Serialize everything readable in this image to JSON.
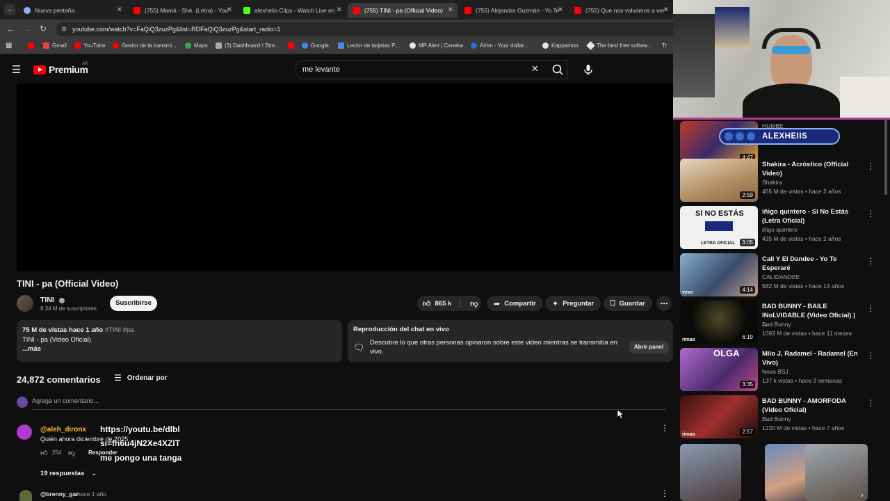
{
  "browser": {
    "tabs": [
      {
        "title": "Nueva pestaña",
        "color": "#8ab4f8"
      },
      {
        "title": "(755) Mamá - Shé. (Letra) - You",
        "color": "#ff0000"
      },
      {
        "title": "alexheiis Clips - Watch Live on",
        "color": "#53fc18"
      },
      {
        "title": "(755) TINI - pa (Official Video)",
        "color": "#ff0000"
      },
      {
        "title": "(755) Alejandra Guzmán - Yo Te",
        "color": "#ff0000"
      },
      {
        "title": "(755) Que nos volvamos a ver",
        "color": "#ff0000"
      }
    ],
    "url": "youtube.com/watch?v=FaQiQ3zuzPg&list=RDFaQiQ3zuzPg&start_radio=1",
    "bookmarks": [
      {
        "label": "Gmail",
        "color": "#ea4335"
      },
      {
        "label": "YouTube",
        "color": "#ff0000"
      },
      {
        "label": "Gestor de la transmi...",
        "color": "#ff0000"
      },
      {
        "label": "Maps",
        "color": "#34a853"
      },
      {
        "label": "(3) Dashboard / Stre...",
        "color": "#aaaaaa"
      },
      {
        "label": "",
        "color": "#ff0000"
      },
      {
        "label": "Google",
        "color": "#4285f4"
      },
      {
        "label": "Lector de tarjetas P...",
        "color": "#4a90d9"
      },
      {
        "label": "MP Alert | Ceneka",
        "color": "#e6e6e6"
      },
      {
        "label": "Airtm - Your dollar...",
        "color": "#2b6ecc"
      },
      {
        "label": "Kappamon",
        "color": "#e6e6e6"
      },
      {
        "label": "The best free softwa...",
        "color": "#e6e6e6"
      },
      {
        "label": "Tr",
        "color": "#e6e6e6"
      }
    ]
  },
  "youtube": {
    "logo": "Premium",
    "region": "AR",
    "search_value": "me levante"
  },
  "video": {
    "title": "TINI - pa (Official Video)",
    "channel": "TINI",
    "subscribers": "9.34 M de suscriptores",
    "subscribe_label": "Suscribirse",
    "likes": "865 k",
    "share_label": "Compartir",
    "ask_label": "Preguntar",
    "save_label": "Guardar",
    "desc_stats": "75 M de vistas  hace 1 año",
    "desc_tags": "#TINI #pa",
    "desc_line": "TINI - pa (Video Oficial)",
    "desc_more": "...más",
    "chat_title": "Reproducción del chat en vivo",
    "chat_text": "Descubre lo que otras personas opinaron sobre este video mientras se transmitía en vivo.",
    "chat_button": "Abrir panel"
  },
  "comments": {
    "count": "24,872 comentarios",
    "sort_label": "Ordenar por",
    "placeholder": "Agrega un comentario...",
    "first": {
      "author": "@aleh_dironx",
      "overlay_line1": "https://youtu.be/dlbl",
      "overlay_line2": "si=fh6u4jN2Xe4XZIT",
      "overlay_line3": "me pongo una tanga",
      "text": "Quién ahora diciembre de 2025",
      "likes": "254",
      "reply_label": "Responder",
      "replies": "19 respuestas"
    },
    "second": {
      "author": "@brenny_gar",
      "time": "hace 1 año"
    }
  },
  "stream_overlay": {
    "name": "ALEXHEIIS"
  },
  "recommendations": [
    {
      "title": "",
      "channel": "HUMBE",
      "meta": "",
      "duration": "4:47",
      "color": "#4a3a6a"
    },
    {
      "title": "Shakira - Acróstico (Official Video)",
      "channel": "Shakira",
      "meta": "455 M de vistas • hace 2 años",
      "duration": "2:59",
      "color": "#c8a27a"
    },
    {
      "title": "iñigo quintero - Si No Estás (Letra Oficial)",
      "channel": "iñigo quintero",
      "meta": "435 M de vistas • hace 2 años",
      "duration": "3:05",
      "color": "#e8e8e8"
    },
    {
      "title": "Cali Y El Dandee - Yo Te Esperaré",
      "channel": "CALIDANDEE",
      "meta": "582 M de vistas • hace 14 años",
      "duration": "4:14",
      "color": "#5a7a9a"
    },
    {
      "title": "BAD BUNNY - BAILE INoLVIDABLE (Video Oficial) | ...",
      "channel": "Bad Bunny",
      "meta": "1093 M de vistas • hace 11 meses",
      "duration": "6:19",
      "color": "#1a1a12"
    },
    {
      "title": "Milo J, Radamel - Radamel (En Vivo)",
      "channel": "Nova BSJ",
      "meta": "137 k vistas • hace 3 semanas",
      "duration": "3:35",
      "color": "#8a5ab0"
    },
    {
      "title": "BAD BUNNY - AMORFODA (Video Oficial)",
      "channel": "Bad Bunny",
      "meta": "1220 M de vistas • hace 7 años",
      "duration": "2:57",
      "color": "#7a2a2a"
    }
  ],
  "thumb_texts": {
    "si_no_estas": "SI NO ESTÁS",
    "letra_oficial": "LETRA OFICIAL",
    "olga": "OLGA",
    "vevo": "vevo",
    "rimas": "rimas"
  }
}
